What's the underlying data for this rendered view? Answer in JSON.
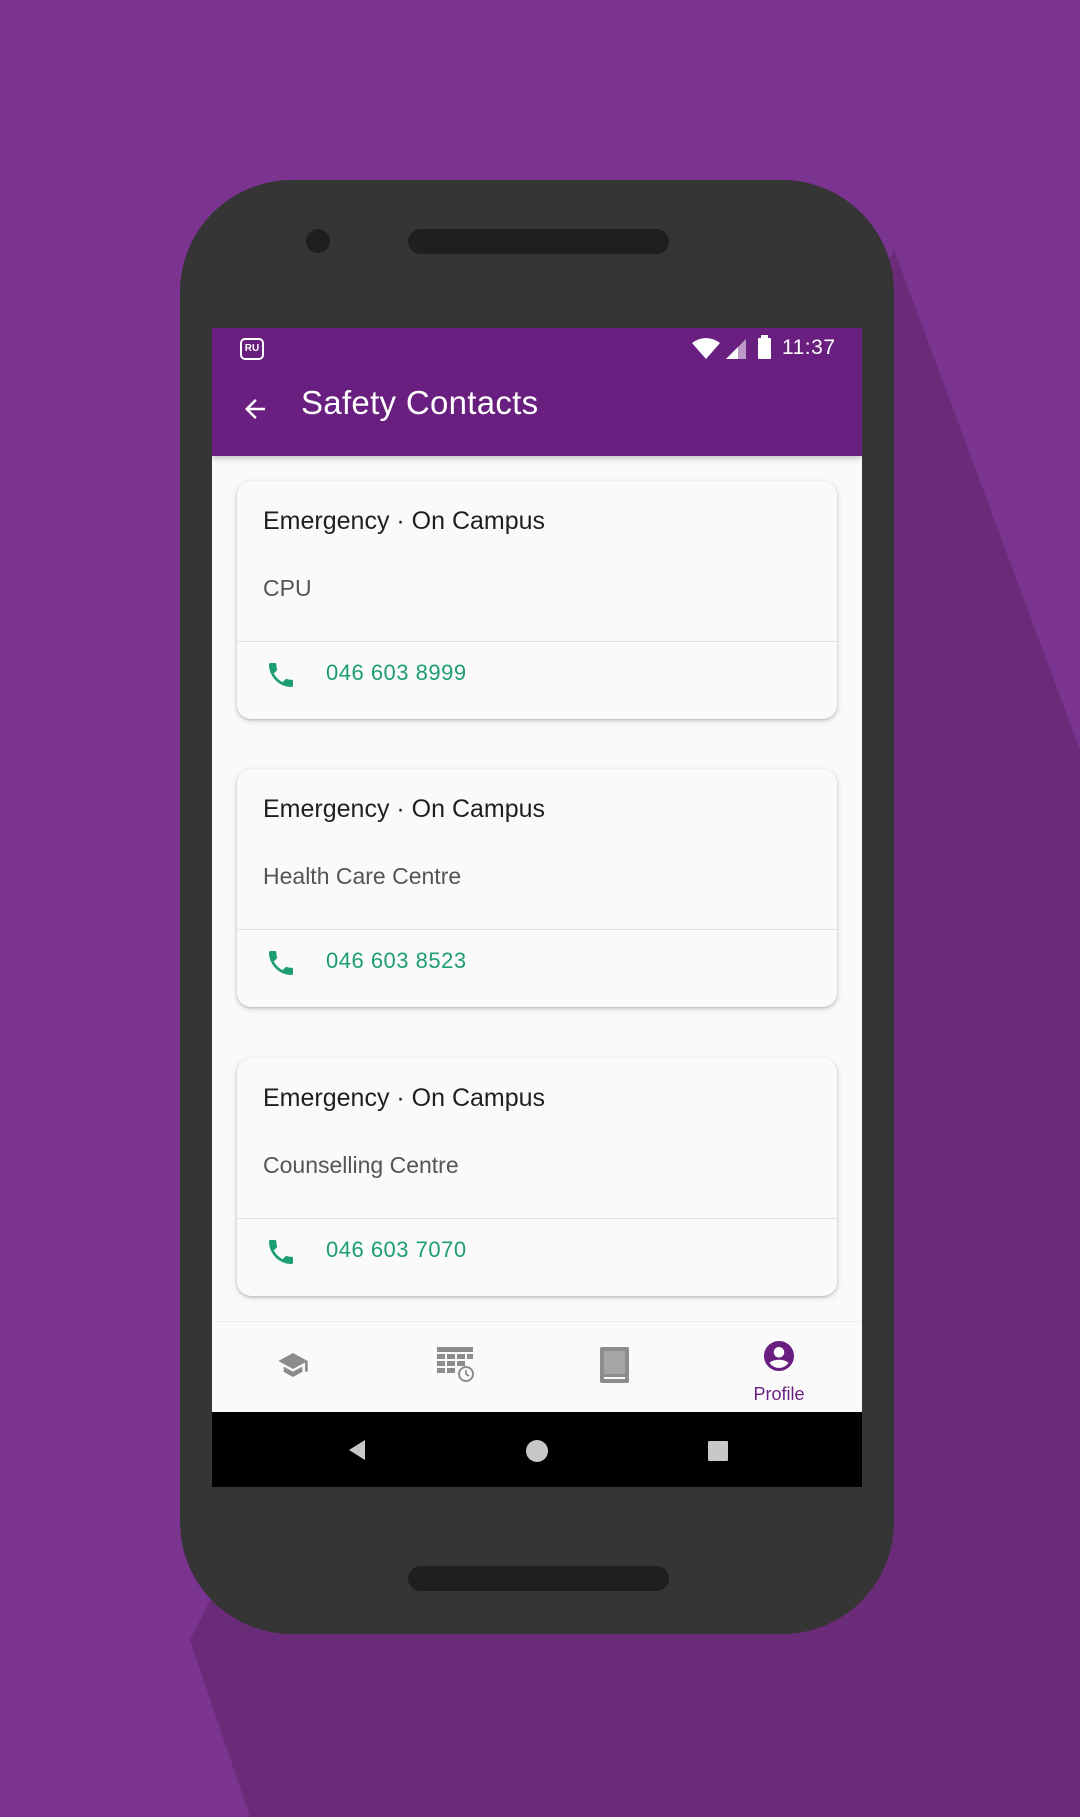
{
  "status_bar": {
    "app_badge": "RU",
    "time": "11:37"
  },
  "appbar": {
    "title": "Safety Contacts"
  },
  "contacts": [
    {
      "category": "Emergency · On Campus",
      "name": "CPU",
      "phone": "046 603 8999"
    },
    {
      "category": "Emergency · On Campus",
      "name": "Health Care Centre",
      "phone": "046 603 8523"
    },
    {
      "category": "Emergency · On Campus",
      "name": "Counselling Centre",
      "phone": "046 603 7070"
    }
  ],
  "bottom_nav": {
    "items": [
      {
        "icon": "graduation-cap-icon",
        "label": ""
      },
      {
        "icon": "timetable-icon",
        "label": ""
      },
      {
        "icon": "book-icon",
        "label": ""
      },
      {
        "icon": "profile-icon",
        "label": "Profile",
        "active": true
      }
    ]
  },
  "colors": {
    "background": "#7b3590",
    "appbar": "#681f7f",
    "accent_green": "#1d9e6f",
    "device_body": "#353535"
  }
}
